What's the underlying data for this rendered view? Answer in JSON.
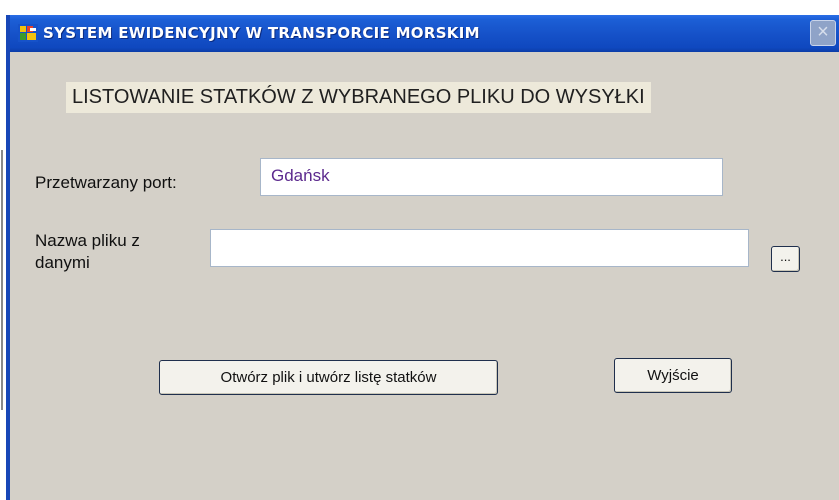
{
  "window": {
    "title": "SYSTEM  EWIDENCYJNY  W  TRANSPORCIE  MORSKIM",
    "close_label": "×"
  },
  "heading": "LISTOWANIE STATKÓW Z WYBRANEGO PLIKU DO WYSYŁKI",
  "form": {
    "port_label": "Przetwarzany port:",
    "port_value": "Gdańsk",
    "file_label": "Nazwa pliku z danymi",
    "file_value": "",
    "browse_label": "..."
  },
  "buttons": {
    "open_label": "Otwórz plik i  utwórz listę statków",
    "exit_label": "Wyjście"
  },
  "colors": {
    "titlebar": "#1652c9",
    "window_bg": "#d4d0c8",
    "port_text": "#5c2a8e"
  },
  "icons": {
    "app": "app-ship-icon",
    "close": "close-icon"
  }
}
